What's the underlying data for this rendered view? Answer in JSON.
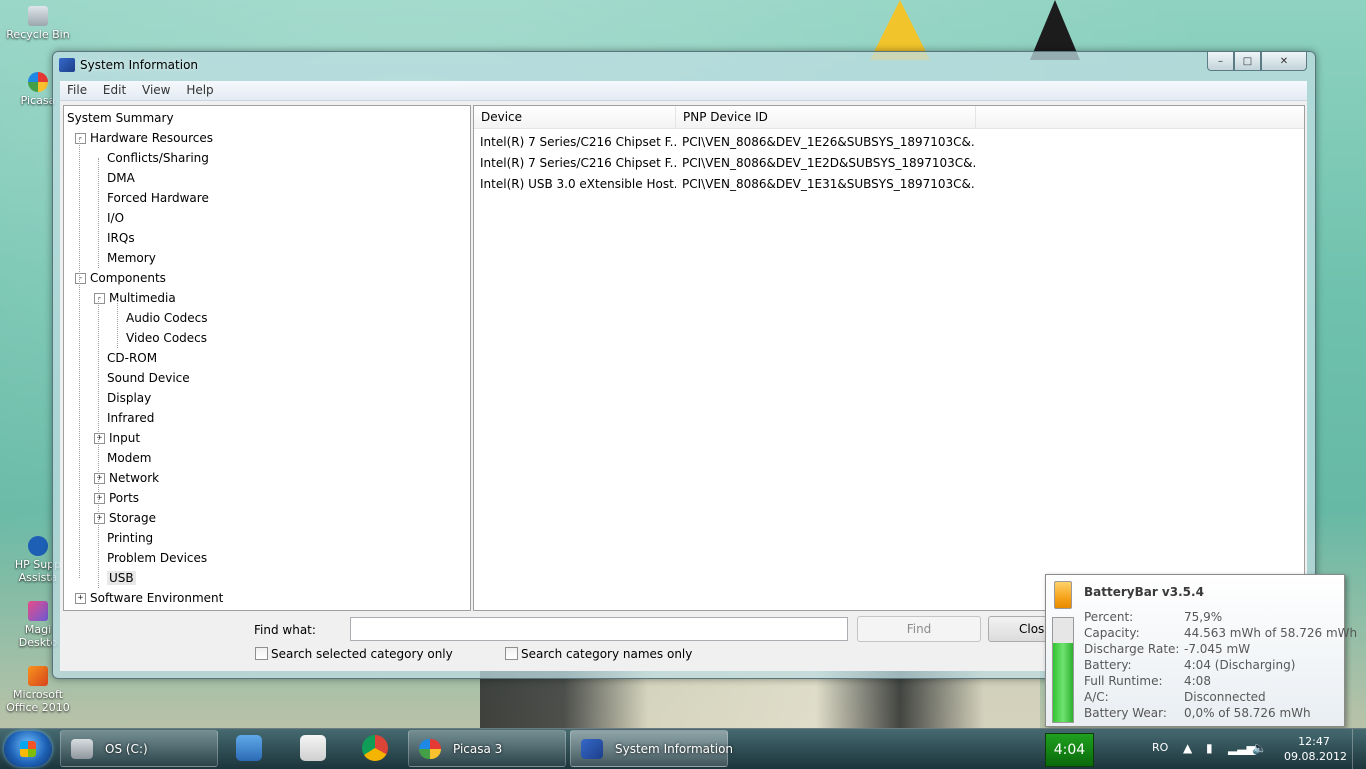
{
  "desktop": {
    "icons": [
      {
        "label": "Recycle Bin",
        "icon": "recycle-bin-icon"
      },
      {
        "label": "Picasa",
        "icon": "picasa-icon"
      },
      {
        "label": "HP Supp Assista",
        "icon": "hp-support-icon"
      },
      {
        "label": "Magi Deskto",
        "icon": "magic-desktop-icon"
      },
      {
        "label": "Microsoft Office 2010",
        "icon": "office-icon"
      }
    ]
  },
  "window": {
    "title": "System Information",
    "menu": [
      "File",
      "Edit",
      "View",
      "Help"
    ],
    "tree": [
      {
        "label": "System Summary",
        "level": 0,
        "expander": ""
      },
      {
        "label": "Hardware Resources",
        "level": 1,
        "expander": "-"
      },
      {
        "label": "Conflicts/Sharing",
        "level": 2,
        "expander": ""
      },
      {
        "label": "DMA",
        "level": 2,
        "expander": ""
      },
      {
        "label": "Forced Hardware",
        "level": 2,
        "expander": ""
      },
      {
        "label": "I/O",
        "level": 2,
        "expander": ""
      },
      {
        "label": "IRQs",
        "level": 2,
        "expander": ""
      },
      {
        "label": "Memory",
        "level": 2,
        "expander": ""
      },
      {
        "label": "Components",
        "level": 1,
        "expander": "-"
      },
      {
        "label": "Multimedia",
        "level": 2,
        "expander": "-"
      },
      {
        "label": "Audio Codecs",
        "level": 3,
        "expander": ""
      },
      {
        "label": "Video Codecs",
        "level": 3,
        "expander": ""
      },
      {
        "label": "CD-ROM",
        "level": 2,
        "expander": ""
      },
      {
        "label": "Sound Device",
        "level": 2,
        "expander": ""
      },
      {
        "label": "Display",
        "level": 2,
        "expander": ""
      },
      {
        "label": "Infrared",
        "level": 2,
        "expander": ""
      },
      {
        "label": "Input",
        "level": 2,
        "expander": "+"
      },
      {
        "label": "Modem",
        "level": 2,
        "expander": ""
      },
      {
        "label": "Network",
        "level": 2,
        "expander": "+"
      },
      {
        "label": "Ports",
        "level": 2,
        "expander": "+"
      },
      {
        "label": "Storage",
        "level": 2,
        "expander": "+"
      },
      {
        "label": "Printing",
        "level": 2,
        "expander": ""
      },
      {
        "label": "Problem Devices",
        "level": 2,
        "expander": ""
      },
      {
        "label": "USB",
        "level": 2,
        "expander": "",
        "selected": true
      },
      {
        "label": "Software Environment",
        "level": 1,
        "expander": "+"
      }
    ],
    "list": {
      "columns": [
        "Device",
        "PNP Device ID"
      ],
      "rows": [
        [
          "Intel(R) 7 Series/C216 Chipset F...",
          "PCI\\VEN_8086&DEV_1E26&SUBSYS_1897103C&..."
        ],
        [
          "Intel(R) 7 Series/C216 Chipset F...",
          "PCI\\VEN_8086&DEV_1E2D&SUBSYS_1897103C&..."
        ],
        [
          "Intel(R) USB 3.0 eXtensible Host...",
          "PCI\\VEN_8086&DEV_1E31&SUBSYS_1897103C&..."
        ]
      ]
    },
    "find": {
      "label": "Find what:",
      "value": "",
      "find_button": "Find",
      "close_button": "Clos",
      "chk_selected": "Search selected category only",
      "chk_names": "Search category names only"
    }
  },
  "batterybar": {
    "title": "BatteryBar v3.5.4",
    "level_fraction": 0.759,
    "rows": [
      {
        "k": "Percent:",
        "v": "75,9%"
      },
      {
        "k": "Capacity:",
        "v": "44.563 mWh of 58.726 mWh"
      },
      {
        "k": "Discharge Rate:",
        "v": "-7.045 mW"
      },
      {
        "k": "Battery:",
        "v": "4:04 (Discharging)"
      },
      {
        "k": "Full Runtime:",
        "v": "4:08"
      },
      {
        "k": "A/C:",
        "v": "Disconnected"
      },
      {
        "k": "Battery Wear:",
        "v": "0,0% of 58.726 mWh"
      }
    ]
  },
  "taskbar": {
    "buttons": [
      {
        "label": "OS (C:)",
        "icon": "drive-icon"
      },
      {
        "label": "Picasa 3",
        "icon": "picasa-icon"
      },
      {
        "label": "System Information",
        "icon": "system-information-icon"
      }
    ],
    "battery_time": "4:04",
    "language": "RO",
    "clock_time": "12:47",
    "clock_date": "09.08.2012",
    "colors": {
      "battery_green": "#1fa01f"
    }
  }
}
